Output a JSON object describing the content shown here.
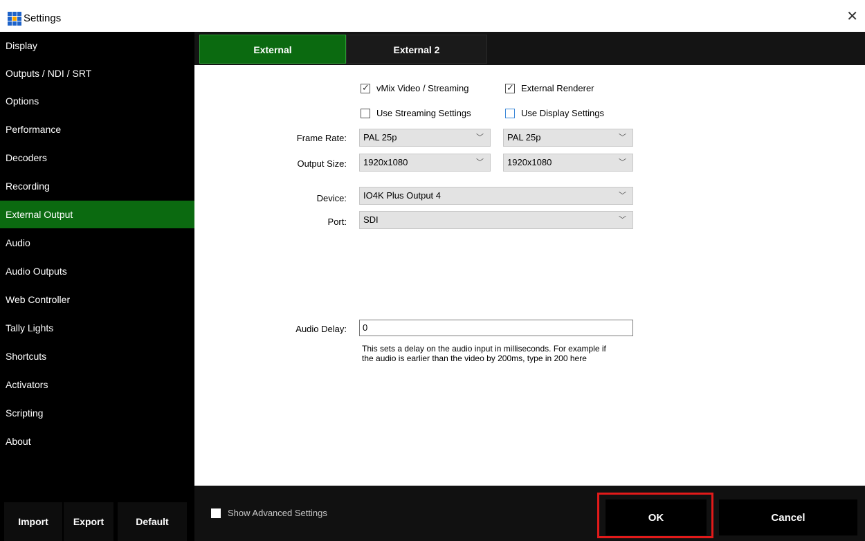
{
  "window": {
    "title": "Settings",
    "close_glyph": "✕"
  },
  "sidebar": {
    "items": [
      {
        "label": "Display",
        "active": false
      },
      {
        "label": "Outputs / NDI / SRT",
        "active": false
      },
      {
        "label": "Options",
        "active": false
      },
      {
        "label": "Performance",
        "active": false
      },
      {
        "label": "Decoders",
        "active": false
      },
      {
        "label": "Recording",
        "active": false
      },
      {
        "label": "External Output",
        "active": true
      },
      {
        "label": "Audio",
        "active": false
      },
      {
        "label": "Audio Outputs",
        "active": false
      },
      {
        "label": "Web Controller",
        "active": false
      },
      {
        "label": "Tally Lights",
        "active": false
      },
      {
        "label": "Shortcuts",
        "active": false
      },
      {
        "label": "Activators",
        "active": false
      },
      {
        "label": "Scripting",
        "active": false
      },
      {
        "label": "About",
        "active": false
      }
    ],
    "footer": {
      "import_label": "Import",
      "export_label": "Export",
      "default_label": "Default"
    }
  },
  "tabs": [
    {
      "label": "External",
      "active": true
    },
    {
      "label": "External 2",
      "active": false
    }
  ],
  "form": {
    "vmix_video_streaming": {
      "label": "vMix Video / Streaming",
      "checked": true
    },
    "external_renderer": {
      "label": "External Renderer",
      "checked": true
    },
    "use_streaming_settings": {
      "label": "Use Streaming Settings",
      "checked": false
    },
    "use_display_settings": {
      "label": "Use Display Settings",
      "checked": false
    },
    "frame_rate": {
      "label": "Frame Rate:",
      "value_1": "PAL 25p",
      "value_2": "PAL 25p"
    },
    "output_size": {
      "label": "Output Size:",
      "value_1": "1920x1080",
      "value_2": "1920x1080"
    },
    "device": {
      "label": "Device:",
      "value": "IO4K Plus Output 4"
    },
    "port": {
      "label": "Port:",
      "value": "SDI"
    },
    "audio_delay": {
      "label": "Audio Delay:",
      "value": "0",
      "help_line_1": "This sets a delay on the audio input in milliseconds. For example if",
      "help_line_2": "the audio is earlier than the video by 200ms, type in 200 here"
    }
  },
  "bottom": {
    "show_advanced_label": "Show Advanced Settings",
    "show_advanced_checked": false,
    "ok_label": "OK",
    "cancel_label": "Cancel"
  },
  "colors": {
    "accent_green": "#0b6a10",
    "sidebar_bg": "#000000",
    "highlight_red": "#e21a1a"
  },
  "icons": {
    "app": "vmix-grid-icon",
    "chevron": "chevron-down-icon",
    "checkmark": "checkmark-icon"
  }
}
